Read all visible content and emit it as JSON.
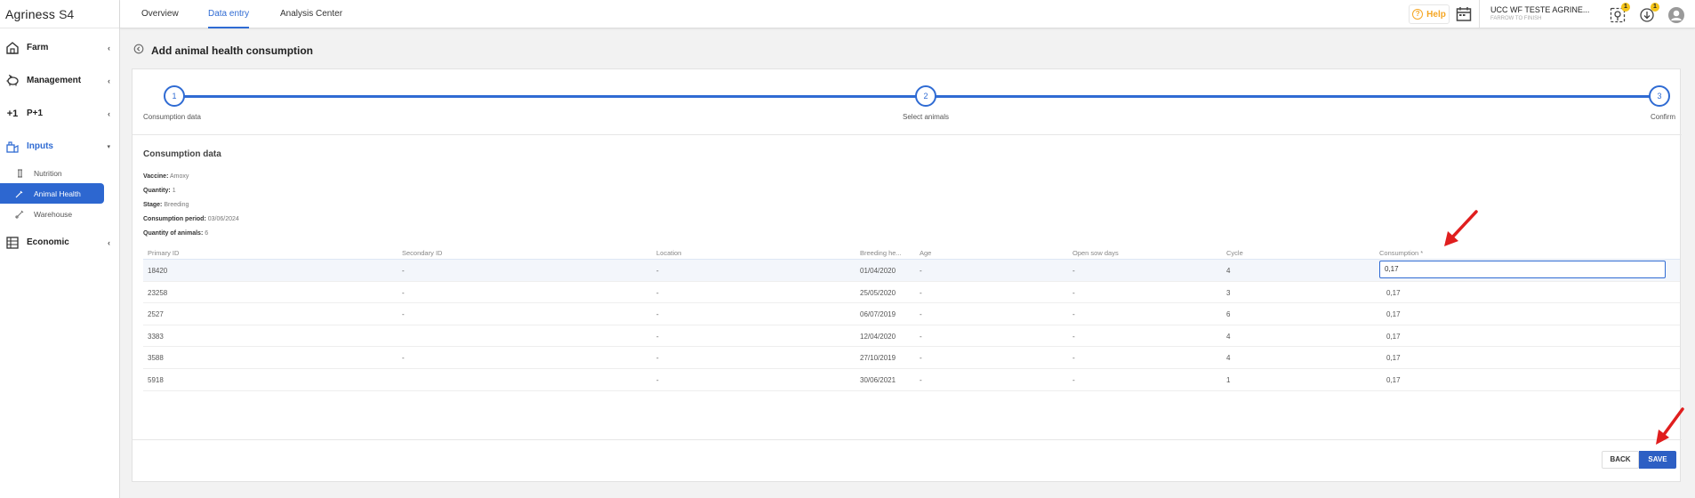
{
  "app": {
    "brand": "Agriness",
    "brand_suffix": "S4"
  },
  "sidebar": {
    "items": [
      {
        "label": "Farm",
        "icon": "farm-house-icon"
      },
      {
        "label": "Management",
        "icon": "pig-icon"
      },
      {
        "label": "P+1",
        "icon": "plus-one-icon"
      },
      {
        "label": "Inputs",
        "icon": "inputs-icon"
      },
      {
        "label": "Economic",
        "icon": "spreadsheet-icon"
      }
    ],
    "inputs_sub": [
      {
        "label": "Nutrition",
        "icon": "nutrition-icon"
      },
      {
        "label": "Animal Health",
        "icon": "syringe-icon"
      },
      {
        "label": "Warehouse",
        "icon": "warehouse-icon"
      }
    ]
  },
  "topbar": {
    "tabs": [
      "Overview",
      "Data entry",
      "Analysis Center"
    ],
    "help_label": "Help",
    "farm_name": "UCC WF TESTE AGRINE...",
    "farm_sub": "FARROW TO FINISH",
    "badge_one": "1",
    "badge_two": "1"
  },
  "page": {
    "title": "Add animal health consumption"
  },
  "stepper": {
    "steps": [
      {
        "number": "1",
        "label": "Consumption data"
      },
      {
        "number": "2",
        "label": "Select animals"
      },
      {
        "number": "3",
        "label": "Confirm"
      }
    ]
  },
  "consumption": {
    "section_title": "Consumption data",
    "vaccine_label": "Vaccine:",
    "vaccine_value": "Amoxy",
    "quantity_label": "Quantity:",
    "quantity_value": "1",
    "stage_label": "Stage:",
    "stage_value": "Breeding",
    "period_label": "Consumption period:",
    "period_value": "03/06/2024",
    "animals_label": "Quantity of animals:",
    "animals_value": "6"
  },
  "table": {
    "headers": [
      "Primary ID",
      "Secondary ID",
      "Location",
      "Breeding he...",
      "Age",
      "Open sow days",
      "Cycle",
      "Consumption *"
    ],
    "rows": [
      [
        "18420",
        "-",
        "-",
        "01/04/2020",
        "-",
        "-",
        "4",
        "0,17"
      ],
      [
        "23258",
        "-",
        "-",
        "25/05/2020",
        "-",
        "-",
        "3",
        "0,17"
      ],
      [
        "2527",
        "-",
        "-",
        "06/07/2019",
        "-",
        "-",
        "6",
        "0,17"
      ],
      [
        "3383",
        "",
        "-",
        "12/04/2020",
        "-",
        "-",
        "4",
        "0,17"
      ],
      [
        "3588",
        "-",
        "-",
        "27/10/2019",
        "-",
        "-",
        "4",
        "0,17"
      ],
      [
        "5918",
        "",
        "-",
        "30/06/2021",
        "-",
        "-",
        "1",
        "0,17"
      ]
    ]
  },
  "footer": {
    "back_label": "BACK",
    "save_label": "SAVE"
  },
  "colors": {
    "accent": "#2f6bd3",
    "save": "#2d5fc4",
    "annotation_arrow": "#e01e1e",
    "help": "#f5a623"
  }
}
